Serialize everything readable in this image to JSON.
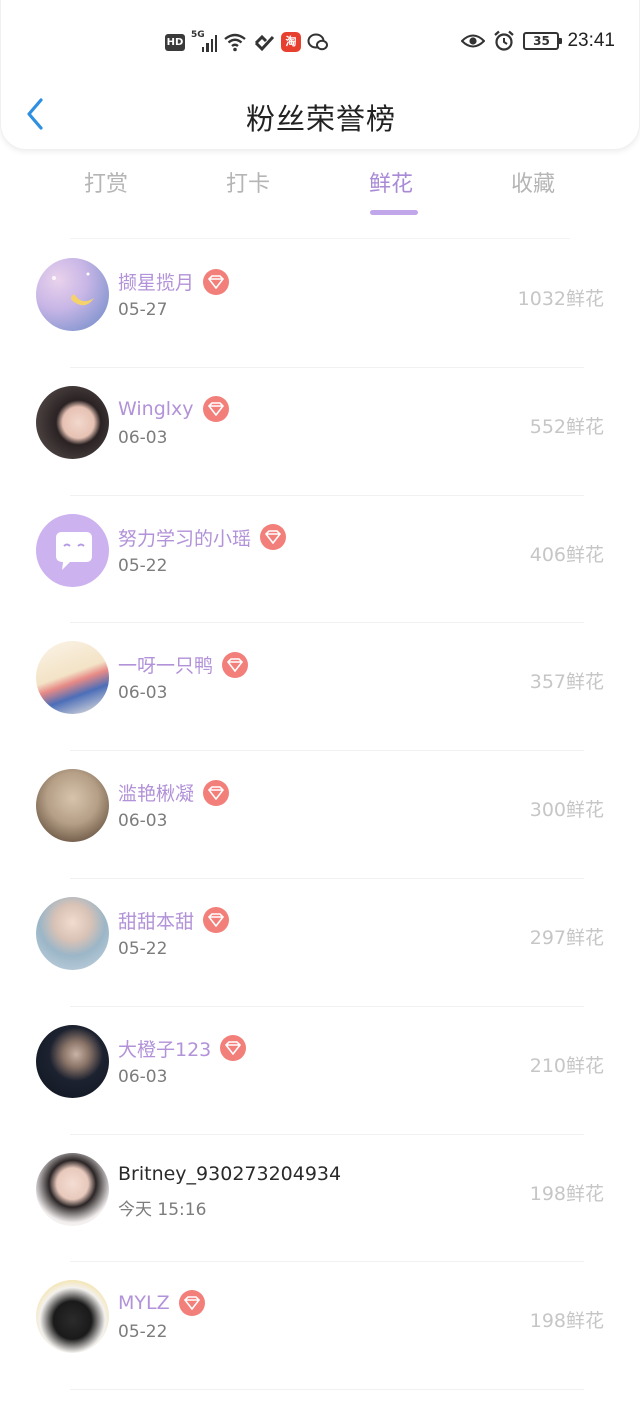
{
  "status_bar": {
    "hd": "HD",
    "network": "5G",
    "app_badge": "淘",
    "time": "23:41",
    "battery": "35",
    "icons": [
      "hd-icon",
      "signal-icon",
      "wifi-icon",
      "hearts-icon",
      "taobao-app-icon",
      "wechat-icon",
      "eye-icon",
      "alarm-icon",
      "battery-icon"
    ]
  },
  "header": {
    "title": "粉丝荣誉榜",
    "back_icon": "chevron-left-icon"
  },
  "tabs": [
    {
      "label": "打赏",
      "active": false
    },
    {
      "label": "打卡",
      "active": false
    },
    {
      "label": "鲜花",
      "active": true
    },
    {
      "label": "收藏",
      "active": false
    }
  ],
  "colors": {
    "accent": "#a98ad6",
    "underline": "#c1a6ea",
    "vip_badge": "#f27f7a",
    "name_purple": "#b292d8",
    "back_blue": "#2f8fe0"
  },
  "list": [
    {
      "name": "撷星揽月",
      "date": "05-27",
      "count": "1032鲜花",
      "vip": true,
      "avatar": "moon-night-avatar"
    },
    {
      "name": "Winglxy",
      "date": "06-03",
      "count": "552鲜花",
      "vip": true,
      "avatar": "girl-portrait-avatar"
    },
    {
      "name": "努力学习的小瑶",
      "date": "05-22",
      "count": "406鲜花",
      "vip": true,
      "avatar": "default-chat-avatar"
    },
    {
      "name": "一呀一只鸭",
      "date": "06-03",
      "count": "357鲜花",
      "vip": true,
      "avatar": "cartoon-cat-avatar"
    },
    {
      "name": "滥艳楸凝",
      "date": "06-03",
      "count": "300鲜花",
      "vip": true,
      "avatar": "ferris-wheel-avatar"
    },
    {
      "name": "甜甜本甜",
      "date": "05-22",
      "count": "297鲜花",
      "vip": true,
      "avatar": "boy-portrait-avatar"
    },
    {
      "name": "大橙子123",
      "date": "06-03",
      "count": "210鲜花",
      "vip": true,
      "avatar": "dark-portrait-avatar"
    },
    {
      "name": "Britney_930273204934",
      "date": "今天 15:16",
      "count": "198鲜花",
      "vip": false,
      "avatar": "man-portrait-avatar"
    },
    {
      "name": "MYLZ",
      "date": "05-22",
      "count": "198鲜花",
      "vip": true,
      "avatar": "black-cat-avatar"
    }
  ]
}
